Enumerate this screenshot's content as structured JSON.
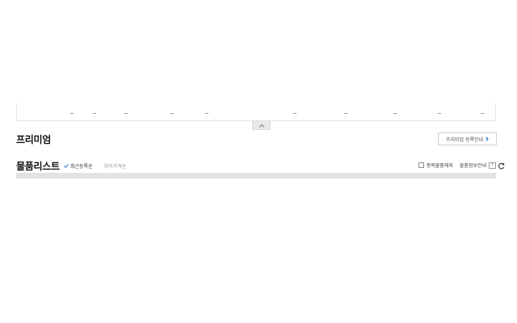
{
  "filter_strip": {
    "dashes": [
      "-",
      "-",
      "-",
      "-",
      "-",
      "-",
      "-",
      "-",
      "-",
      "-"
    ]
  },
  "premium": {
    "title": "프리미엄",
    "guide_button_label": "프리미엄 등록안내"
  },
  "item_list": {
    "title": "물품리스트",
    "sort_tabs": [
      {
        "label": "최근등록순",
        "active": true
      },
      {
        "label": "최저가격순",
        "active": false
      }
    ],
    "dedupe_label": "중복물품제외",
    "dedupe_checked": false,
    "info_guide_label": "물품정보안내",
    "help_label": "?"
  },
  "icons": {
    "collapse": "chevron-up-icon",
    "guide_arrow": "chevron-right-icon",
    "active_sort": "check-icon",
    "refresh": "refresh-icon"
  },
  "colors": {
    "accent_blue": "#2b7bd6",
    "arrow_blue": "#1f6fd1"
  }
}
